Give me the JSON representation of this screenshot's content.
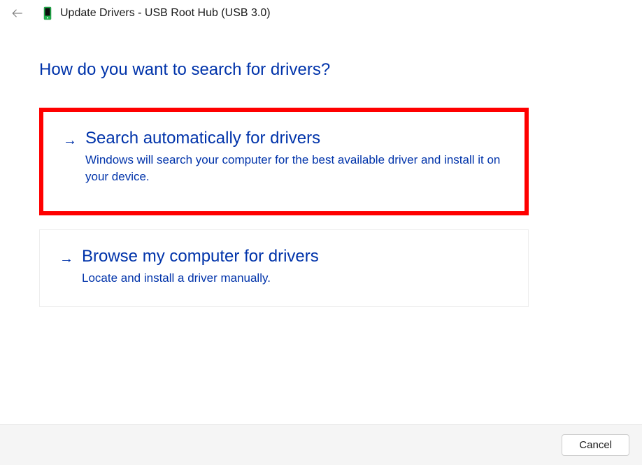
{
  "header": {
    "title": "Update Drivers - USB Root Hub (USB 3.0)"
  },
  "prompt": "How do you want to search for drivers?",
  "options": [
    {
      "title": "Search automatically for drivers",
      "description": "Windows will search your computer for the best available driver and install it on your device.",
      "highlighted": true
    },
    {
      "title": "Browse my computer for drivers",
      "description": "Locate and install a driver manually.",
      "highlighted": false
    }
  ],
  "footer": {
    "cancel_label": "Cancel"
  }
}
